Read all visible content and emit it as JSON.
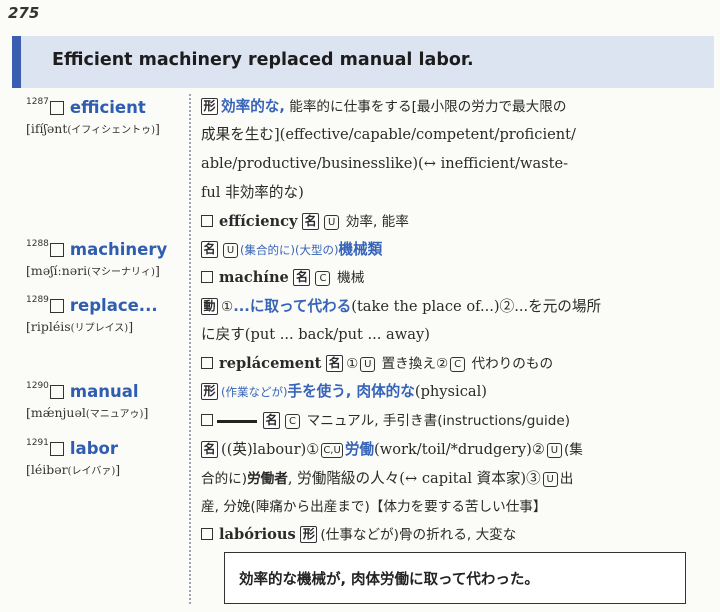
{
  "page_number": "275",
  "banner": {
    "sentence": "Efficient machinery replaced manual labor."
  },
  "entries": [
    {
      "num": "1287",
      "word": "efficient",
      "pron": "[ifíʃənt",
      "kana": "(イフィシェントゥ)",
      "pron_end": "]"
    },
    {
      "num": "1288",
      "word": "machinery",
      "pron": "[məʃíːnəri",
      "kana": "(マシーナリィ)",
      "pron_end": "]"
    },
    {
      "num": "1289",
      "word": "replace...",
      "pron": "[ripléis",
      "kana": "(リプレイス)",
      "pron_end": "]"
    },
    {
      "num": "1290",
      "word": "manual",
      "pron": "[mǽnjuəl",
      "kana": "(マニュアゥ)",
      "pron_end": "]"
    },
    {
      "num": "1291",
      "word": "labor",
      "pron": "[léibər",
      "kana": "(レイバァ)",
      "pron_end": "]"
    }
  ],
  "defs": {
    "efficient": {
      "pos": "形",
      "l1_blue": "効率的な,",
      "l1_rest": " 能率的に仕事をする[最小限の労力で最大限の",
      "l2": "成果を生む](effective/capable/competent/proficient/",
      "l3": "able/productive/businesslike)(↔ inefficient/waste-",
      "l4": "ful 非効率的な)",
      "deriv_word": "effíciency",
      "deriv_pos": "名",
      "deriv_u": "U",
      "deriv_meaning": "効率, 能率"
    },
    "machinery": {
      "pos": "名",
      "u": "U",
      "l1_blue_small": "(集合的に)(大型の)",
      "l1_blue": "機械類",
      "deriv_word": "machíne",
      "deriv_pos": "名",
      "deriv_c": "C",
      "deriv_meaning": "機械"
    },
    "replace": {
      "pos": "動",
      "l1_num1": "①",
      "l1_blue": "...に取って代わる",
      "l1_rest": "(take the place of...)②...を元の場所",
      "l2": "に戻す(put ... back/put ... away)",
      "deriv_word": "replácement",
      "deriv_pos": "名",
      "deriv_meaning_a": "①",
      "deriv_u": "U",
      "deriv_meaning_b": " 置き換え②",
      "deriv_c": "C",
      "deriv_meaning_c": " 代わりのもの"
    },
    "manual": {
      "pos": "形",
      "l1_blue_small": "(作業などが)",
      "l1_blue": "手を使う, 肉体的な",
      "l1_rest": "(physical)",
      "deriv_pos": "名",
      "deriv_c": "C",
      "deriv_meaning": "マニュアル, 手引き書(instructions/guide)"
    },
    "labor": {
      "pos": "名",
      "l1_a": "((英)labour)①",
      "l1_cu": "C,U",
      "l1_blue": "労働",
      "l1_b": "(work/toil/*drudgery)②",
      "l1_u": "U",
      "l1_c": "(集",
      "l2_a": "合的に)",
      "l2_bold": "労働者",
      "l2_b": ", 労働階級の人々(↔ capital 資本家)③",
      "l2_u": "U",
      "l2_c": "出",
      "l3": "産, 分娩(陣痛から出産まで)【体力を要する苦しい仕事】",
      "deriv_word": "labórious",
      "deriv_pos": "形",
      "deriv_small": "(仕事などが)",
      "deriv_meaning": "骨の折れる, 大変な"
    }
  },
  "summary": "効率的な機械が, 肉体労働に取って代わった。"
}
